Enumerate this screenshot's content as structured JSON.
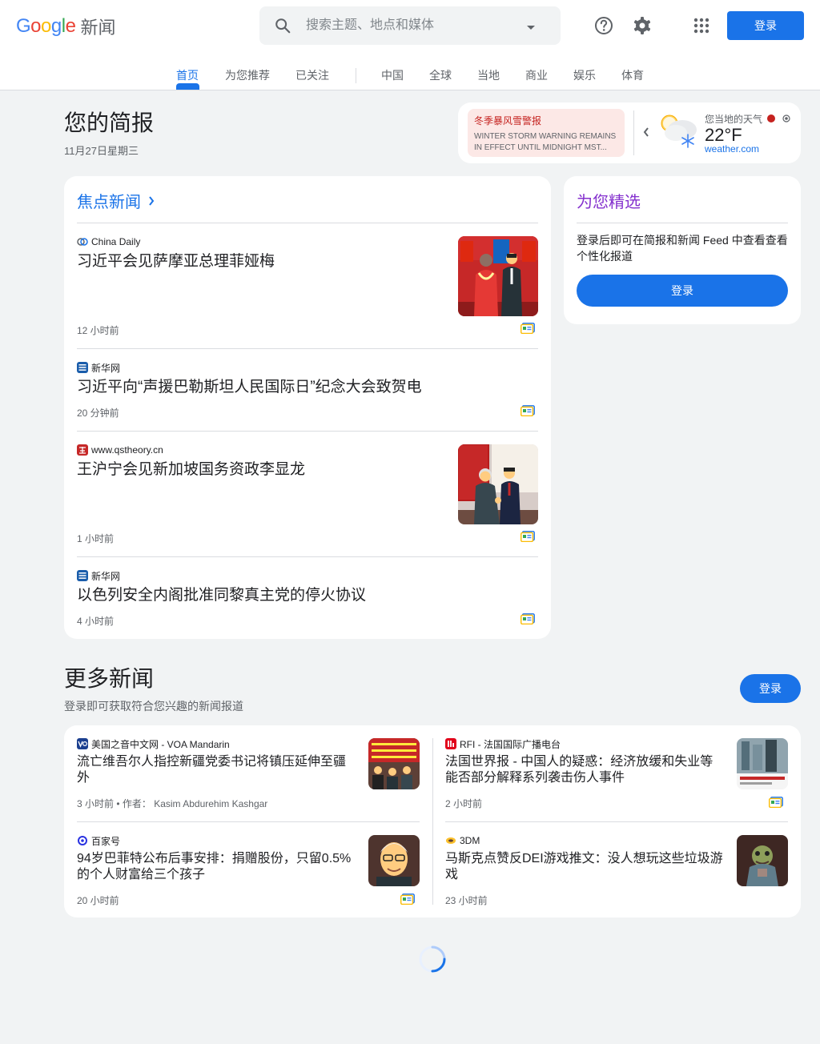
{
  "header": {
    "logo_word": "Google",
    "logo_product": "新闻",
    "search_placeholder": "搜索主题、地点和媒体",
    "login_label": "登录",
    "icons": [
      "search-icon",
      "dropdown-icon",
      "help-icon",
      "settings-icon",
      "apps-icon"
    ]
  },
  "tabs": [
    {
      "label": "首页",
      "active": true
    },
    {
      "label": "为您推荐"
    },
    {
      "label": "已关注"
    },
    {
      "label": "中国"
    },
    {
      "label": "全球"
    },
    {
      "label": "当地"
    },
    {
      "label": "商业"
    },
    {
      "label": "娱乐"
    },
    {
      "label": "体育"
    }
  ],
  "briefing": {
    "title": "您的简报",
    "date": "11月27日星期三"
  },
  "weather": {
    "alert_title": "冬季暴风雪警报",
    "alert_text": "WINTER STORM WARNING REMAINS IN EFFECT UNTIL MIDNIGHT MST...",
    "label": "您当地的天气",
    "temperature": "22°F",
    "source": "weather.com"
  },
  "top_stories": {
    "heading": "焦点新闻",
    "stories": [
      {
        "source": "China Daily",
        "headline": "习近平会见萨摩亚总理菲娅梅",
        "time": "12 小时前"
      },
      {
        "source": "新华网",
        "headline": "习近平向“声援巴勒斯坦人民国际日”纪念大会致贺电",
        "time": "20 分钟前"
      },
      {
        "source": "www.qstheory.cn",
        "headline": "王沪宁会见新加坡国务资政李显龙",
        "time": "1 小时前"
      },
      {
        "source": "新华网",
        "headline": "以色列安全内阁批准同黎真主党的停火协议",
        "time": "4 小时前"
      }
    ]
  },
  "picks": {
    "title": "为您精选",
    "text": "登录后即可在简报和新闻 Feed 中查看查看个性化报道",
    "button": "登录"
  },
  "more_news": {
    "title": "更多新闻",
    "subtitle": "登录即可获取符合您兴趣的新闻报道",
    "button": "登录",
    "stories": [
      {
        "source": "美国之音中文网 - VOA Mandarin",
        "headline": "流亡维吾尔人指控新疆党委书记将镇压延伸至疆外",
        "time": "3 小时前 • 作者： Kasim Abdurehim Kashgar"
      },
      {
        "source": "RFI - 法国国际广播电台",
        "headline": "法国世界报 - 中国人的疑惑：经济放缓和失业等能否部分解释系列袭击伤人事件",
        "time": "2 小时前"
      },
      {
        "source": "百家号",
        "headline": "94岁巴菲特公布后事安排：捐赠股份，只留0.5%的个人财富给三个孩子",
        "time": "20 小时前"
      },
      {
        "source": "3DM",
        "headline": "马斯克点赞反DEI游戏推文：没人想玩这些垃圾游戏",
        "time": "23 小时前"
      }
    ]
  },
  "colors": {
    "accent": "#1a73e8",
    "picks": "#8430ce",
    "alert": "#c5221f",
    "background": "#f1f3f4"
  }
}
